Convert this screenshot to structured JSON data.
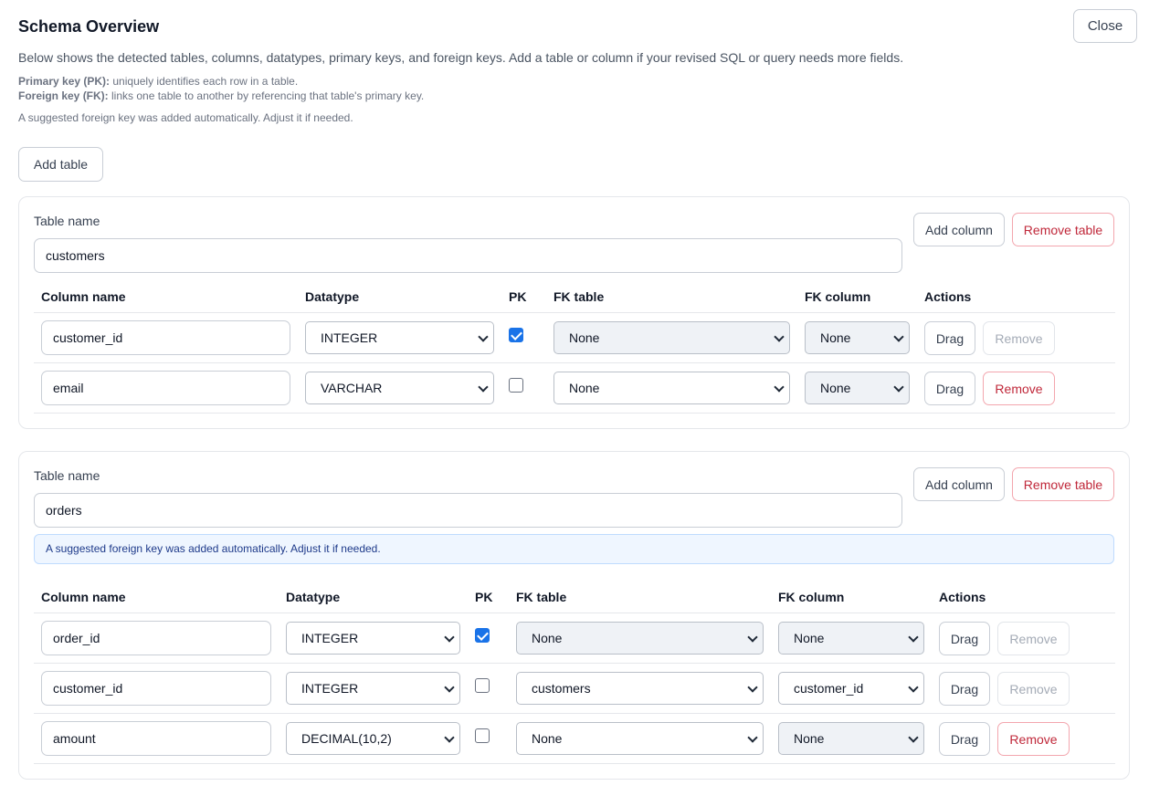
{
  "header": {
    "title": "Schema Overview",
    "close_label": "Close",
    "description": "Below shows the detected tables, columns, datatypes, primary keys, and foreign keys. Add a table or column if your revised SQL or query needs more fields.",
    "pk_term": "Primary key (PK):",
    "pk_text": " uniquely identifies each row in a table.",
    "fk_term": "Foreign key (FK):",
    "fk_text": " links one table to another by referencing that table's primary key.",
    "suggestion_note": "A suggested foreign key was added automatically. Adjust it if needed.",
    "add_table_label": "Add table"
  },
  "labels": {
    "table_name": "Table name",
    "add_column": "Add column",
    "remove_table": "Remove table",
    "col_column_name": "Column name",
    "col_datatype": "Datatype",
    "col_pk": "PK",
    "col_fk_table": "FK table",
    "col_fk_column": "FK column",
    "col_actions": "Actions",
    "drag": "Drag",
    "remove": "Remove"
  },
  "tables": [
    {
      "name": "customers",
      "columns": [
        {
          "name": "customer_id",
          "datatype": "INTEGER",
          "pk": true,
          "fk_table": "None",
          "fk_column": "None",
          "remove_enabled": false
        },
        {
          "name": "email",
          "datatype": "VARCHAR",
          "pk": false,
          "fk_table": "None",
          "fk_column": "None",
          "remove_enabled": true
        }
      ]
    },
    {
      "name": "orders",
      "info": "A suggested foreign key was added automatically. Adjust it if needed.",
      "columns": [
        {
          "name": "order_id",
          "datatype": "INTEGER",
          "pk": true,
          "fk_table": "None",
          "fk_column": "None",
          "remove_enabled": false
        },
        {
          "name": "customer_id",
          "datatype": "INTEGER",
          "pk": false,
          "fk_table": "customers",
          "fk_column": "customer_id",
          "remove_enabled": false
        },
        {
          "name": "amount",
          "datatype": "DECIMAL(10,2)",
          "pk": false,
          "fk_table": "None",
          "fk_column": "None",
          "remove_enabled": true
        }
      ]
    }
  ]
}
